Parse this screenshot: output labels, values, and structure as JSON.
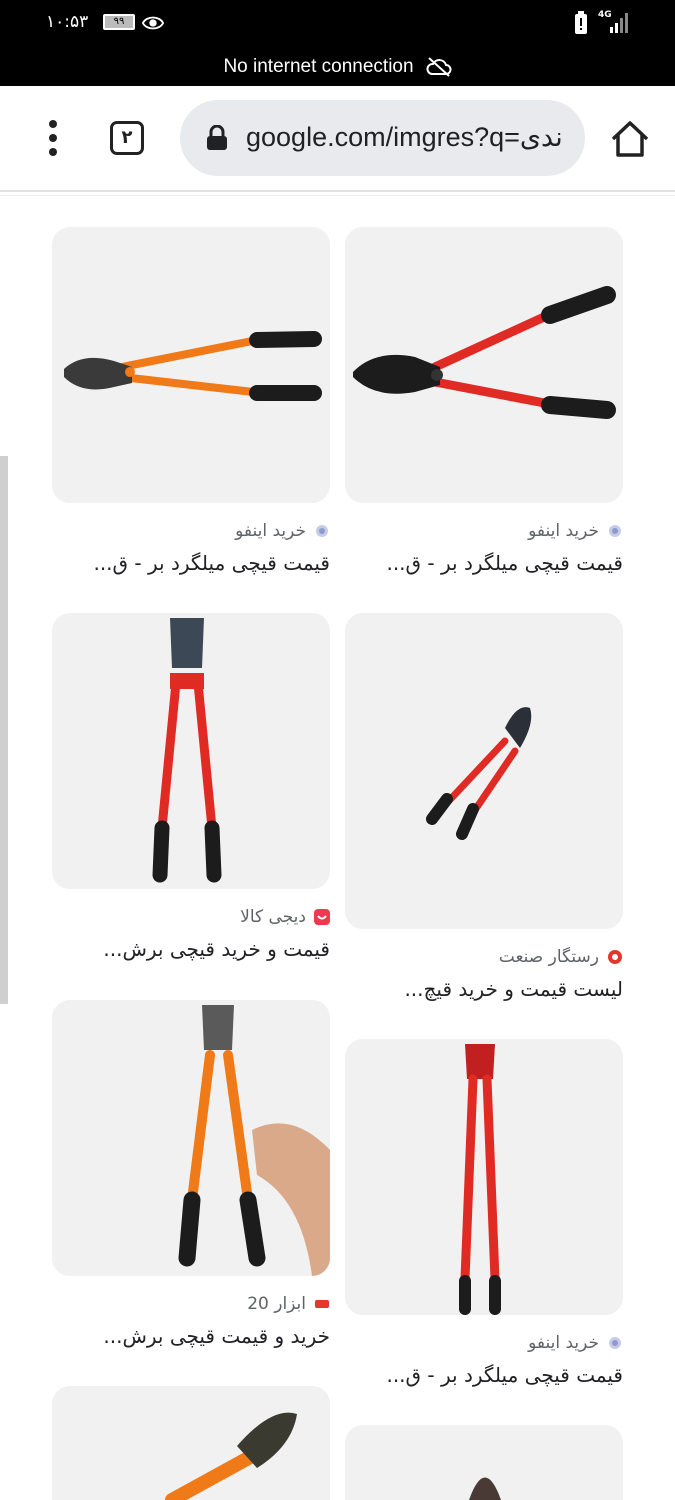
{
  "status_bar": {
    "time": "۱۰:۵۳",
    "battery_level": "۹۹",
    "network": "4G"
  },
  "offline_banner": {
    "text": "No internet connection"
  },
  "toolbar": {
    "tab_count": "۲",
    "url": "google.com/imgres?q=ندی"
  },
  "results": [
    {
      "source": "خرید اینفو",
      "title": "قیمت قیچی میلگرد بر - ق..."
    },
    {
      "source": "خرید اینفو",
      "title": "قیمت قیچی میلگرد بر - ق..."
    },
    {
      "source": "رستگار صنعت",
      "title": "لیست قیمت و خرید قیچ..."
    },
    {
      "source": "دیجی کالا",
      "title": "قیمت و خرید قیچی برش..."
    },
    {
      "source": "خرید اینفو",
      "title": "قیمت قیچی میلگرد بر - ق..."
    },
    {
      "source": "ابزار 20",
      "title": "خرید و قیمت قیچی برش..."
    },
    {
      "source": "",
      "title": ""
    },
    {
      "source": "",
      "title": ""
    }
  ],
  "colors": {
    "red_tool": "#e02b25",
    "orange_tool": "#f07a18",
    "handle": "#1c1c1c",
    "card_bg": "#f1f1f1",
    "digikala": "#ef394e",
    "rastegar": "#e4372c"
  }
}
